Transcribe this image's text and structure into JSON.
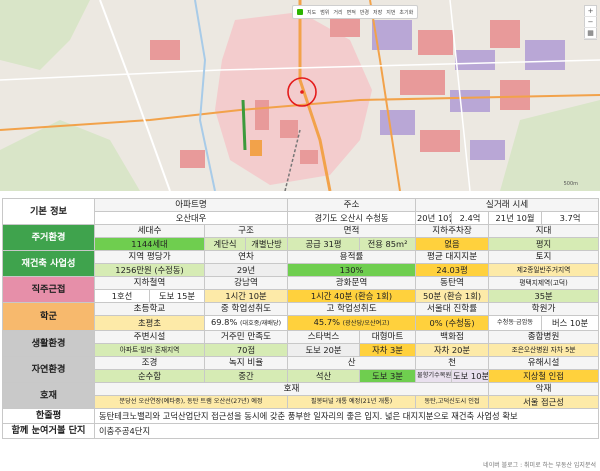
{
  "map": {
    "toolbar": [
      "지도",
      "범위",
      "거리",
      "면적",
      "반경",
      "저장",
      "지번",
      "초기화"
    ],
    "scale": "500m",
    "colors": {
      "land": "#ece8e1",
      "highlight": "#f4c7c9",
      "residential": "#e89a9a",
      "industrial": "#b9a7d6",
      "road_main": "#f2a24a",
      "rail": "#3c9a3c",
      "marker_circle": "#e41b1b"
    }
  },
  "table": {
    "rows": {
      "basic": {
        "label": "기본 정보",
        "h": [
          "아파트명",
          "주소",
          "실거래 시세"
        ],
        "v": [
          "오산대우",
          "경기도 오산시 수청동",
          "20년 10월",
          "2.4억",
          "21년 10월",
          "3.7억"
        ]
      },
      "living": {
        "label": "주거환경",
        "h": [
          "세대수",
          "구조",
          "면적",
          "지하주차장",
          "지대"
        ],
        "v": [
          "1144세대",
          "계단식",
          "개별난방",
          "공급 31평",
          "전용 85m²",
          "없음",
          "평지"
        ]
      },
      "rebuild": {
        "label": "재건축 사업성",
        "h": [
          "지역 평당가",
          "연차",
          "용적률",
          "평균 대지지분",
          "토지"
        ],
        "v": [
          "1256만원 (수정동)",
          "29년",
          "130%",
          "24.03평",
          "제2종일반주거지역"
        ]
      },
      "commute": {
        "label": "직주근접",
        "h": [
          "지하철역",
          "강남역",
          "광화문역",
          "동탄역",
          "평택지제역(고덕)"
        ],
        "v": [
          "1호선",
          "도보 15분",
          "1시간 10분",
          "1시간 40분 (환승 1회)",
          "50분 (환승 1회)",
          "35분"
        ]
      },
      "school": {
        "label": "학군",
        "h": [
          "초등학교",
          "중 학업성취도",
          "고 학업성취도",
          "서울대 진학률",
          "학원가"
        ],
        "v": [
          "초평초",
          "69.8%",
          "(대호중/재배당)",
          "45.7%",
          "(광산당/오산여고)",
          "0% (수청동)",
          "수청동·금암동",
          "버스 10분"
        ]
      },
      "life": {
        "label": "생활환경",
        "h": [
          "주변시설",
          "거주민 만족도",
          "스타벅스",
          "대형마트",
          "백화점",
          "종합병원"
        ],
        "v": [
          "아파트·빌라 혼재지역",
          "70점",
          "도보 20분",
          "자차 3분",
          "자차 20분",
          "조은오산병원",
          "자차 5분"
        ]
      },
      "nature": {
        "label": "자연환경",
        "h": [
          "조경",
          "녹지 비율",
          "산",
          "천",
          "유해시설"
        ],
        "v": [
          "순수함",
          "중간",
          "석산",
          "도보 3분",
          "물향기수목원",
          "도보 10분",
          "지상철 인접"
        ]
      },
      "plus": {
        "label": "호재",
        "h": [
          "호재",
          "악재"
        ],
        "v": [
          "분당선 오산연장(예타중), 동탄 트램 오산선(27년) 예정",
          "필봉터널 개통 예정(21년 개통)",
          "동탄,고덕신도시 인접",
          "서울 접근성"
        ]
      },
      "summary": {
        "label": "한줄평",
        "v": "동탄테크노밸리와 고덕산업단지 접근성을 동시에 갖춘 풍부한 일자리의 좋은 입지. 넓은 대지지분으로 재건축 사업성 확보"
      },
      "together": {
        "label": "함께 눈여거볼 단지",
        "v": "이충주공4단지"
      }
    }
  },
  "footer": "네이버 블로그 : 취미로 하는 부동산 입지분석"
}
